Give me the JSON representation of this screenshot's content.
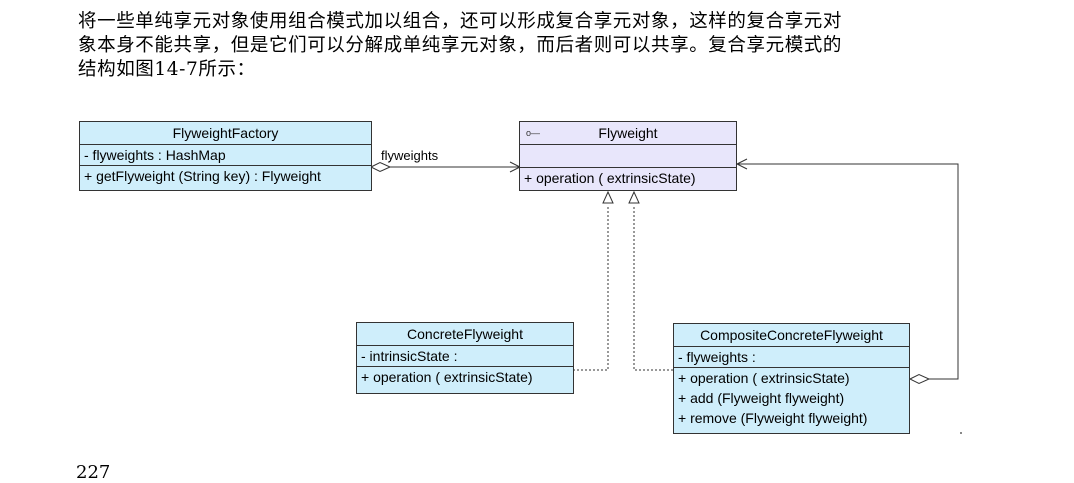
{
  "paragraph": {
    "lines": [
      "将一些单纯享元对象使用组合模式加以组合，还可以形成复合享元对象，这样的复合享元对",
      "象本身不能共享，但是它们可以分解成单纯享元对象，而后者则可以共享。复合享元模式的",
      "结构如图14-7所示："
    ]
  },
  "diagram": {
    "flyweight_factory": {
      "name": "FlyweightFactory",
      "attributes": [
        "- flyweights : HashMap"
      ],
      "operations": [
        "+ getFlyweight (String key) : Flyweight"
      ]
    },
    "flyweight": {
      "name": "Flyweight",
      "attributes": [],
      "operations": [
        "+ operation ( extrinsicState)"
      ]
    },
    "concrete_flyweight": {
      "name": "ConcreteFlyweight",
      "attributes": [
        "- intrinsicState :"
      ],
      "operations": [
        "+ operation ( extrinsicState)"
      ]
    },
    "composite_flyweight": {
      "name": "CompositeConcreteFlyweight",
      "attributes": [
        "- flyweights :"
      ],
      "operations": [
        "+ operation ( extrinsicState)",
        "+ add (Flyweight flyweight)",
        "+ remove (Flyweight flyweight)"
      ]
    },
    "association_label": "flyweights"
  },
  "page_number": "227"
}
